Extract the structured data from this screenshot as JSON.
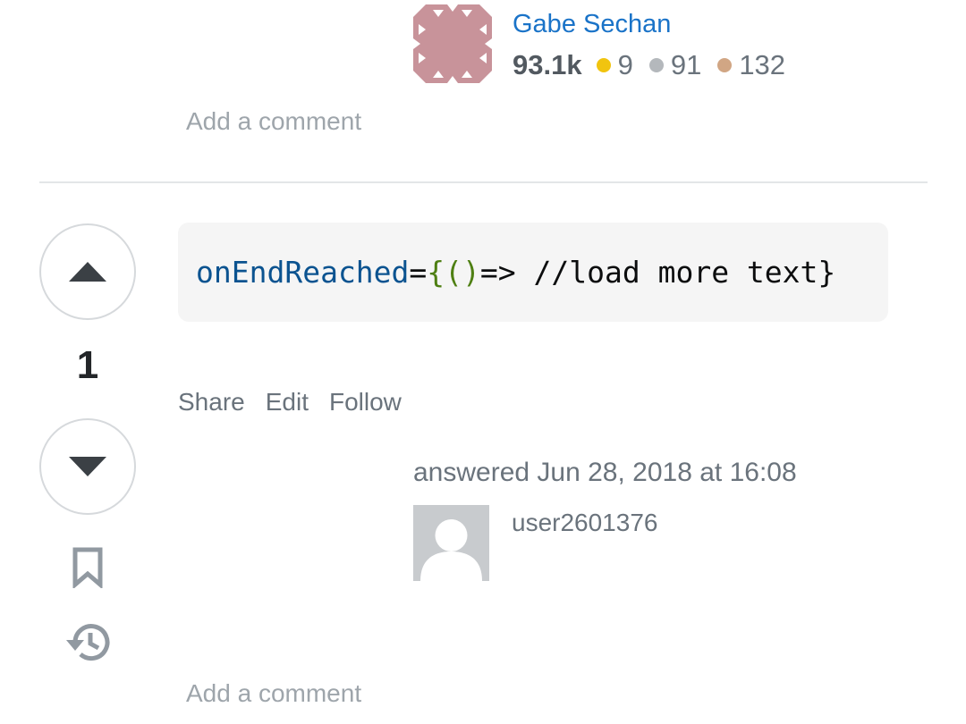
{
  "previous_answer": {
    "user": {
      "name": "Gabe Sechan",
      "reputation": "93.1k",
      "badges": {
        "gold": "9",
        "silver": "91",
        "bronze": "132"
      },
      "avatar_color": "#c8939a"
    },
    "add_comment_label": "Add a comment"
  },
  "answer": {
    "score": "1",
    "code": {
      "identifier": "onEndReached",
      "equals": "=",
      "open_brace": "{",
      "parens": "()",
      "rest": "=> //load more text",
      "close_brace": "}"
    },
    "menu": {
      "share": "Share",
      "edit": "Edit",
      "follow": "Follow"
    },
    "answered_text": "answered Jun 28, 2018 at 16:08",
    "user": {
      "name": "user2601376"
    },
    "add_comment_label": "Add a comment"
  },
  "icons": {
    "upvote": "triangle-up-icon",
    "downvote": "triangle-down-icon",
    "bookmark": "bookmark-icon",
    "history": "history-icon"
  },
  "colors": {
    "link": "#1a73c8",
    "gold": "#f1c40f",
    "silver": "#b4b8bc",
    "bronze": "#d1a684"
  }
}
